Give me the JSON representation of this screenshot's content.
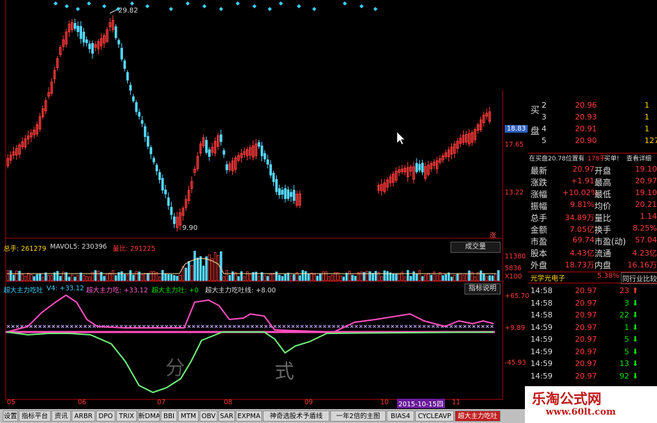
{
  "colors": {
    "up": "#ff3b3b",
    "down": "#55d8ff",
    "line_pink": "#ff4fc0",
    "line_green": "#6ff07a",
    "axis_red": "#ff3b3b"
  },
  "price_annotations": {
    "high": "29.82",
    "low": "9.90"
  },
  "price_axis": [
    "18.83",
    "17.65",
    "13.22"
  ],
  "volume_axis": [
    "11380",
    "5836",
    "X100"
  ],
  "osc_axis": [
    "+65.70",
    "+9.89",
    "-45.93"
  ],
  "x_labels": [
    "05",
    "06",
    "07",
    "08",
    "09",
    "10",
    "11"
  ],
  "date_marker": "2015-10-15四",
  "volume_legend": {
    "total": "总手: 261279",
    "mavol": "MAVOL5: 230396",
    "ratio": "量比: 291225"
  },
  "volume_button": "成交量",
  "indicator_legend": {
    "name": "超大主力吃吐",
    "v4": "V4: +33.12",
    "eat": "超大主力吃: +33.12",
    "spit": "超大主力吐: +0",
    "gauge": "超大主力吃吐线: +8.00"
  },
  "indicator_button": "指标说明",
  "chart_overlay": {
    "a": "分",
    "b": "式"
  },
  "sidebar_marker": "涨",
  "quote": {
    "order_book": {
      "label_buy": "买",
      "label_sell": "盘",
      "rows": [
        {
          "lvl": "2",
          "price": "20.96",
          "vol": "1"
        },
        {
          "lvl": "3",
          "price": "20.93",
          "vol": "1"
        },
        {
          "lvl": "4",
          "price": "20.91",
          "vol": "1"
        },
        {
          "lvl": "5",
          "price": "20.90",
          "vol": "127"
        }
      ]
    },
    "queue_line": {
      "a": "在买盘20.78位置有",
      "b": "178手",
      "c": "买单!",
      "d": "查看详细"
    },
    "stats": [
      {
        "k1": "最新",
        "v1": "20.97",
        "k2": "开盘",
        "v2": "19.10"
      },
      {
        "k1": "涨跌",
        "v1": "+1.91",
        "k2": "最高",
        "v2": "20.97"
      },
      {
        "k1": "涨幅",
        "v1": "+10.02%",
        "k2": "最低",
        "v2": "19.10"
      },
      {
        "k1": "振幅",
        "v1": "9.81%",
        "k2": "均价",
        "v2": "20.21"
      },
      {
        "k1": "总手",
        "v1": "34.89万",
        "k2": "量比",
        "v2": "1.14"
      },
      {
        "k1": "金额",
        "v1": "7.05亿",
        "k2": "换手",
        "v2": "8.25%"
      },
      {
        "k1": "市盈",
        "v1": "69.74",
        "k2": "市盈(动)",
        "v2": "57.04"
      },
      {
        "k1": "股本",
        "v1": "4.43亿",
        "k2": "流通",
        "v2": "4.23亿"
      },
      {
        "k1": "外盘",
        "v1": "18.73万",
        "k2": "内盘",
        "v2": "16.16万"
      }
    ],
    "sector": {
      "name": "光学光电子",
      "pct": "5.38%",
      "btn": "同行业比较"
    },
    "ticks": [
      {
        "time": "14:58",
        "price": "20.97",
        "vol": "23",
        "dir": "up"
      },
      {
        "time": "14:58",
        "price": "20.97",
        "vol": "3",
        "dir": "down"
      },
      {
        "time": "14:58",
        "price": "20.97",
        "vol": "22",
        "dir": "down"
      },
      {
        "time": "14:59",
        "price": "20.97",
        "vol": "1",
        "dir": "down"
      },
      {
        "time": "14:59",
        "price": "20.97",
        "vol": "5",
        "dir": "down"
      },
      {
        "time": "14:59",
        "price": "20.97",
        "vol": "5",
        "dir": "down"
      },
      {
        "time": "14:59",
        "price": "20.97",
        "vol": "13",
        "dir": "down"
      },
      {
        "time": "14:59",
        "price": "20.97",
        "vol": "92",
        "dir": "down"
      }
    ]
  },
  "tabs": [
    "设置",
    "指标平台",
    "资讯",
    "ARBR",
    "DPO",
    "TRIX",
    "新DMA",
    "BBI",
    "MTM",
    "OBV",
    "SAR",
    "EXPMA",
    "神奇选股术予盾线",
    "一年2倍的主图",
    "BIAS4",
    "CYCLEAVP",
    "超大主力吃吐"
  ],
  "active_tab": "超大主力吃吐",
  "watermark": {
    "line1": "乐淘公式网",
    "line2": "www.60lt.com"
  }
}
